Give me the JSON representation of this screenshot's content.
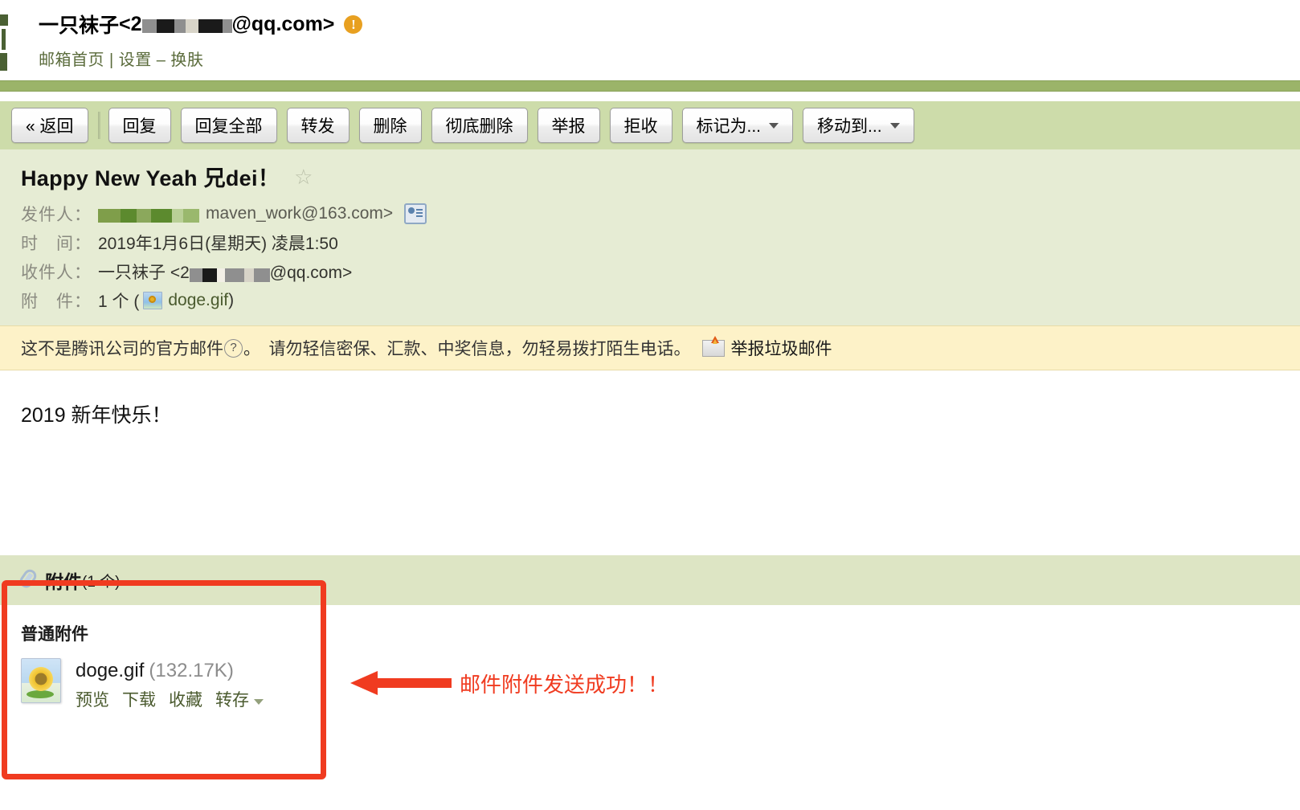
{
  "header": {
    "account_name": "一只袜子",
    "account_email_prefix": "<2",
    "account_email_suffix": "@qq.com>",
    "warning_badge": "!",
    "nav": {
      "home": "邮箱首页",
      "separator": "|",
      "settings": "设置",
      "dash": "–",
      "skin": "换肤"
    }
  },
  "toolbar": {
    "back": "« 返回",
    "reply": "回复",
    "reply_all": "回复全部",
    "forward": "转发",
    "delete": "删除",
    "delete_permanently": "彻底删除",
    "report": "举报",
    "reject": "拒收",
    "mark_as": "标记为...",
    "move_to": "移动到..."
  },
  "mail": {
    "subject": "Happy New Yeah 兄dei！",
    "star_glyph": "☆",
    "from_label": "发件人：",
    "from_value": "maven_work@163.com>",
    "date_label": "时　间：",
    "date_value": "2019年1月6日(星期天) 凌晨1:50",
    "to_label": "收件人：",
    "to_name": "一只袜子",
    "to_email_prefix": "<2",
    "to_email_suffix": "@qq.com>",
    "attach_label": "附　件：",
    "attach_count_text": "1 个 (",
    "attach_file": "doge.gif",
    "attach_close": ")"
  },
  "warning_bar": {
    "text_before": "这不是腾讯公司的官方邮件",
    "qmark": "?",
    "text_after": "。　请勿轻信密保、汇款、中奖信息，勿轻易拨打陌生电话。",
    "report_spam": "举报垃圾邮件"
  },
  "body": {
    "content": "2019 新年快乐！"
  },
  "attachments": {
    "panel_title": "附件",
    "panel_count": "(1 个)",
    "kind_label": "普通附件",
    "file_name": "doge.gif",
    "file_size": "(132.17K)",
    "links": {
      "preview": "预览",
      "download": "下载",
      "favorite": "收藏",
      "save_to": "转存"
    }
  },
  "annotation": {
    "text": "邮件附件发送成功！！",
    "color": "#f03b20"
  },
  "colors": {
    "toolbar_bg": "#cddcaa",
    "divider_green": "#9bb469",
    "mail_head_bg": "#e6ecd4",
    "warning_bg": "#fdf2c8",
    "attach_header_bg": "#dde5c4",
    "link_green": "#4a5a2e",
    "badge_orange": "#e8a020"
  }
}
